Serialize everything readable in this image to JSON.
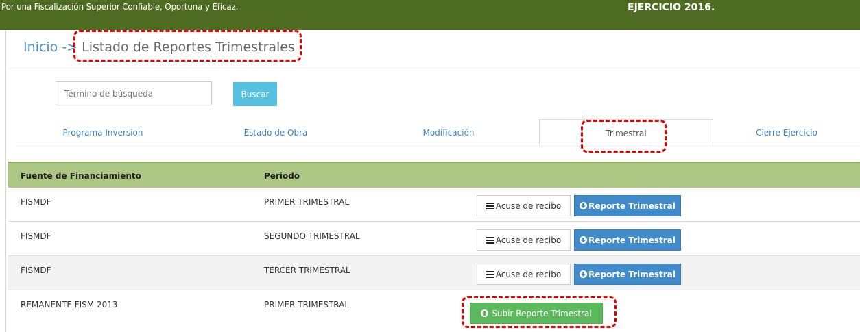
{
  "header": {
    "motto": "Por una Fiscalización Superior Confiable, Oportuna y Eficaz.",
    "ejercicio": "EJERCICIO 2016."
  },
  "breadcrumb": {
    "home": "Inicio",
    "separator": " -> ",
    "current": "Listado de Reportes Trimestrales"
  },
  "search": {
    "placeholder": "Término de búsqueda",
    "button": "Buscar"
  },
  "tabs": [
    {
      "label": "Programa Inversion"
    },
    {
      "label": "Estado de Obra"
    },
    {
      "label": "Modificación"
    },
    {
      "label": "Trimestral"
    },
    {
      "label": "Cierre Ejercicio"
    }
  ],
  "table": {
    "headers": [
      "Fuente de Financiamiento",
      "Periodo"
    ],
    "rows": [
      {
        "fuente": "FISMDF",
        "periodo": "PRIMER TRIMESTRAL",
        "acuse": "Acuse de recibo",
        "reporte": "Reporte Trimestral"
      },
      {
        "fuente": "FISMDF",
        "periodo": "SEGUNDO TRIMESTRAL",
        "acuse": "Acuse de recibo",
        "reporte": "Reporte Trimestral"
      },
      {
        "fuente": "FISMDF",
        "periodo": "TERCER TRIMESTRAL",
        "acuse": "Acuse de recibo",
        "reporte": "Reporte Trimestral"
      },
      {
        "fuente": "REMANENTE FISM 2013",
        "periodo": "PRIMER TRIMESTRAL",
        "subir": "Subir Reporte Trimestral"
      }
    ]
  },
  "colors": {
    "header_bg": "#4e6b22",
    "table_header_bg": "#adc784",
    "primary": "#428bca",
    "success": "#5cb85c",
    "info": "#55c0e0",
    "highlight": "#e60000"
  },
  "icons": {
    "list": "list-icon",
    "download": "circle-arrow-down-icon",
    "upload": "circle-arrow-up-icon"
  }
}
